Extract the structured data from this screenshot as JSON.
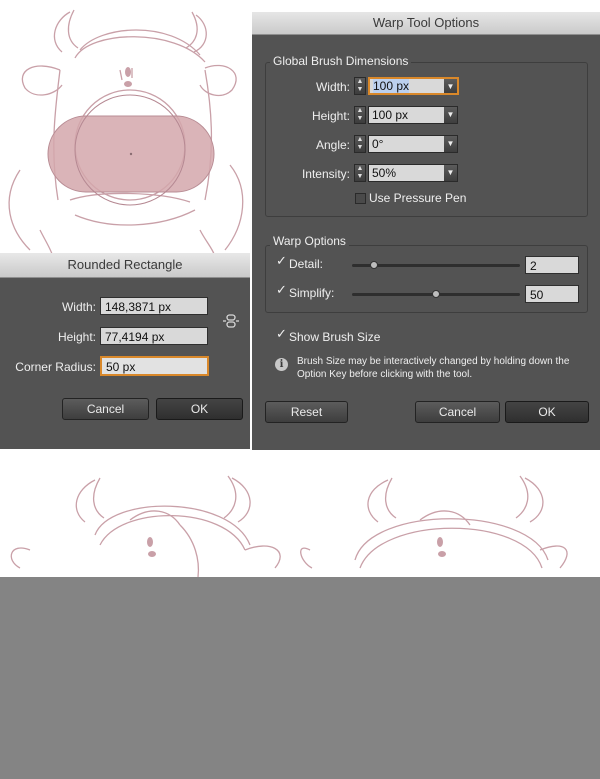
{
  "rounded_rect_dialog": {
    "title": "Rounded Rectangle",
    "width_label": "Width:",
    "width_value": "148,3871 px",
    "height_label": "Height:",
    "height_value": "77,4194 px",
    "radius_label": "Corner Radius:",
    "radius_value": "50 px",
    "cancel": "Cancel",
    "ok": "OK"
  },
  "warp_dialog": {
    "title": "Warp Tool Options",
    "brush_group": "Global Brush Dimensions",
    "width_label": "Width:",
    "width_value": "100 px",
    "height_label": "Height:",
    "height_value": "100 px",
    "angle_label": "Angle:",
    "angle_value": "0°",
    "intensity_label": "Intensity:",
    "intensity_value": "50%",
    "pressure_label": "Use Pressure Pen",
    "warp_group": "Warp Options",
    "detail_label": "Detail:",
    "detail_value": "2",
    "simplify_label": "Simplify:",
    "simplify_value": "50",
    "show_brush_label": "Show Brush Size",
    "info_text_1": "Brush Size may be interactively changed by holding down the",
    "info_text_2": "Option Key before clicking with the tool.",
    "reset": "Reset",
    "cancel": "Cancel",
    "ok": "OK"
  },
  "colors": {
    "dialog_bg": "#535353",
    "focus": "#d9882a",
    "sketch_line": "#c9a0a8",
    "shape_fill": "#d4a7ac"
  }
}
